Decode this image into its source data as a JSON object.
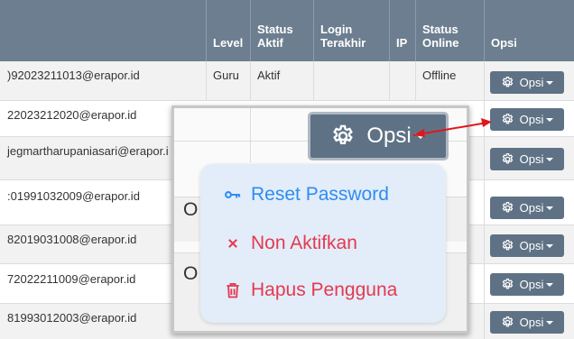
{
  "table": {
    "headers": {
      "level": "Level",
      "status_aktif": "Status Aktif",
      "login_terakhir": "Login Terakhir",
      "ip": "IP",
      "status_online": "Status Online",
      "opsi": "Opsi"
    },
    "rows": [
      {
        "email": ")92023211013@erapor.id",
        "level": "Guru",
        "status_aktif": "Aktif",
        "status_online": "Offline"
      },
      {
        "email": "22023212020@erapor.id"
      },
      {
        "email": "jegmartharupaniasari@erapor.i"
      },
      {
        "email": ":01991032009@erapor.id"
      },
      {
        "email": "82019031008@erapor.id"
      },
      {
        "email": "72022211009@erapor.id"
      },
      {
        "email": "81993012003@erapor.id"
      }
    ],
    "opsi_label": "Opsi"
  },
  "zoom": {
    "opsi_label": "Opsi",
    "partial_letter_1": "O",
    "partial_letter_2": "O"
  },
  "menu": {
    "reset_password": "Reset Password",
    "non_aktifkan": "Non Aktifkan",
    "hapus_pengguna": "Hapus Pengguna"
  },
  "colors": {
    "header_bg": "#6c7e8f",
    "button_bg": "#5f7285",
    "menu_bg": "#e2edf9",
    "link_blue": "#2f8cf0",
    "danger_red": "#e53950",
    "arrow_red": "#e0161d"
  },
  "icons": [
    "gear-icon",
    "caret-down-icon",
    "key-icon",
    "close-icon",
    "trash-icon",
    "arrow-icon"
  ]
}
